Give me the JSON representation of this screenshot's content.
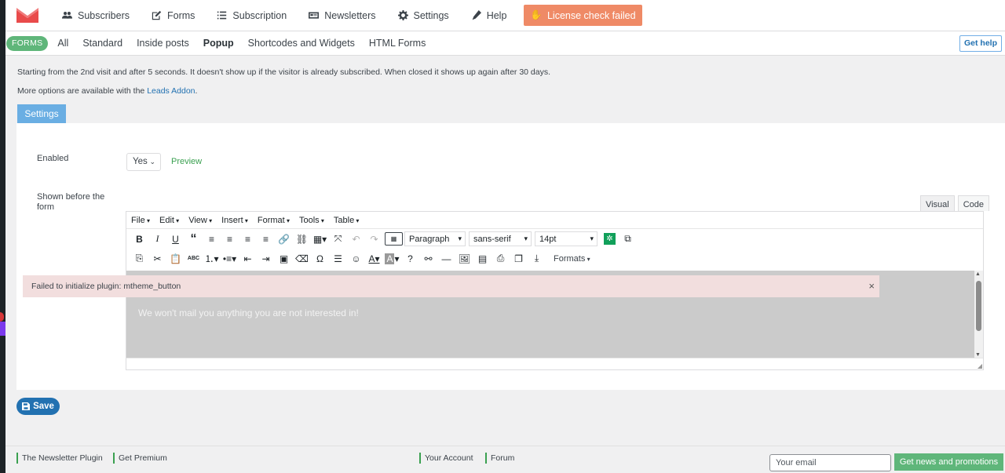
{
  "nav": {
    "items": [
      {
        "label": "Subscribers",
        "icon": "users-icon"
      },
      {
        "label": "Forms",
        "icon": "edit-icon"
      },
      {
        "label": "Subscription",
        "icon": "list-icon"
      },
      {
        "label": "Newsletters",
        "icon": "newspaper-icon"
      },
      {
        "label": "Settings",
        "icon": "gear-icon"
      },
      {
        "label": "Help",
        "icon": "pen-icon"
      }
    ],
    "license_label": "License check failed"
  },
  "subnav": {
    "badge": "FORMS",
    "items": [
      "All",
      "Standard",
      "Inside posts",
      "Popup",
      "Shortcodes and Widgets",
      "HTML Forms"
    ],
    "active": "Popup",
    "help_label": "Get help"
  },
  "description": {
    "line1": "Starting from the 2nd visit and after 5 seconds. It doesn't show up if the visitor is already subscribed. When closed it shows up again after 30 days.",
    "line2_prefix": "More options are available with the ",
    "line2_link": "Leads Addon",
    "line2_suffix": "."
  },
  "settings_tab": "Settings",
  "form": {
    "enabled_label": "Enabled",
    "enabled_value": "Yes",
    "preview_label": "Preview",
    "shown_before_label": "Shown before the form"
  },
  "editor": {
    "tabs": [
      "Visual",
      "Code"
    ],
    "menu": [
      "File",
      "Edit",
      "View",
      "Insert",
      "Format",
      "Tools",
      "Table"
    ],
    "block_format": "Paragraph",
    "font_family": "sans-serif",
    "font_size": "14pt",
    "formats_label": "Formats",
    "content": "We won't mail you anything you are not interested in!"
  },
  "notice": {
    "text": "Failed to initialize plugin: mtheme_button",
    "close": "×"
  },
  "save_label": "Save",
  "footer": {
    "links": [
      "The Newsletter Plugin",
      "Get Premium",
      "Your Account",
      "Forum"
    ],
    "email_placeholder": "Your email",
    "news_button": "Get news and promotions"
  },
  "colors": {
    "accent": "#2271b1",
    "green": "#5fb67a",
    "license": "#ef8a66",
    "notice_bg": "#f2dede"
  }
}
